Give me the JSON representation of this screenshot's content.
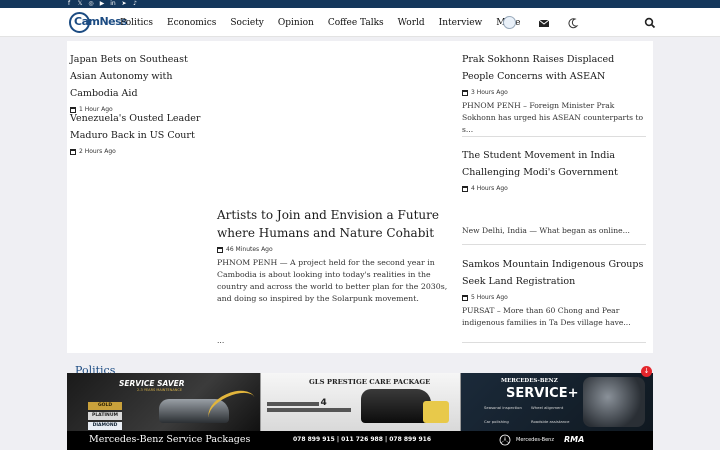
{
  "header": {
    "logo_text": "CamNess",
    "nav": [
      "Politics",
      "Economics",
      "Society",
      "Opinion",
      "Coffee Talks",
      "World",
      "Interview",
      "More"
    ]
  },
  "social_icons": [
    "facebook-icon",
    "x-icon",
    "instagram-icon",
    "youtube-icon",
    "linkedin-icon",
    "telegram-icon",
    "tiktok-icon"
  ],
  "stories": {
    "left1": {
      "title": "Japan Bets on Southeast Asian Autonomy with Cambodia Aid",
      "time": "1 Hour Ago"
    },
    "left2": {
      "title": "Venezuela's Ousted Leader Maduro Back in US Court",
      "time": "2 Hours Ago"
    },
    "feature": {
      "title": "Artists to Join and Envision a Future where Humans and Nature Cohabit",
      "time": "46 Minutes Ago",
      "excerpt": "PHNOM PENH — A project held for the second year in Cambodia is about looking into today's realities in the country and across the world to better plan for the 2030s, and doing so inspired by the Solarpunk movement.",
      "more": "..."
    },
    "right1": {
      "title": "Prak Sokhonn Raises Displaced People Concerns with ASEAN",
      "time": "3 Hours Ago",
      "excerpt": "PHNOM PENH – Foreign Minister Prak Sokhonn has urged his ASEAN counterparts to s..."
    },
    "right2": {
      "title": "The Student Movement in India Challenging Modi's Government",
      "time": "4 Hours Ago",
      "excerpt": "New Delhi, India — What began as online..."
    },
    "right3": {
      "title": "Samkos Mountain Indigenous Groups Seek Land Registration",
      "time": "5 Hours Ago",
      "excerpt": "PURSAT – More than 60 Chong and Pear indigenous families in Ta Des village have..."
    }
  },
  "section": {
    "title": "Politics"
  },
  "ad": {
    "left_title": "SERVICE SAVER",
    "left_sub": "2-3 YEARS MAINTENANCE",
    "tiers": [
      "GOLD",
      "PLATINUM",
      "DIAMOND"
    ],
    "mid_title": "GLS PRESTIGE CARE PACKAGE",
    "mid_number": "4",
    "right_brand": "MERCEDES-BENZ",
    "right_title": "SERVICE+",
    "right_items": [
      "Seasonal inspection",
      "Wheel alignment",
      "Car polishing",
      "Roadside assistance"
    ],
    "tagline": "Mercedes-Benz Service Packages",
    "phones": "078 899 915  |  011 726 988  |  078 899 916",
    "brand": "Mercedes-Benz",
    "dealer": "RMA"
  }
}
